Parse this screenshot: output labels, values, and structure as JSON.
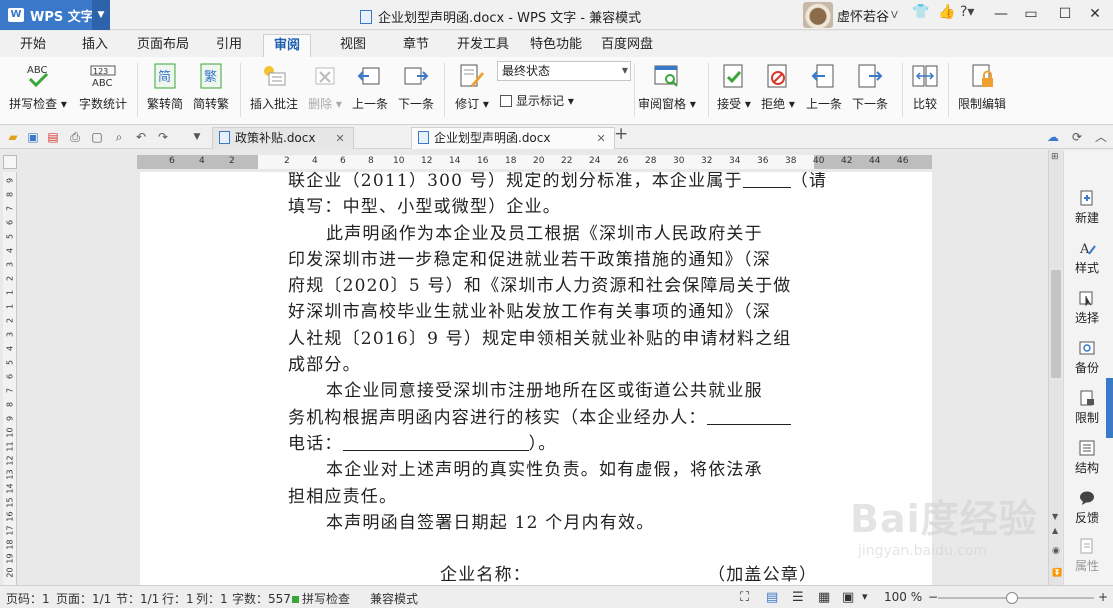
{
  "app": {
    "logo_text": "W",
    "name": "WPS 文字",
    "window_title": "企业划型声明函.docx - WPS 文字 - 兼容模式",
    "user_name": "虚怀若谷"
  },
  "menu_tabs": [
    "开始",
    "插入",
    "页面布局",
    "引用",
    "审阅",
    "视图",
    "章节",
    "开发工具",
    "特色功能",
    "百度网盘"
  ],
  "active_tab": "审阅",
  "ribbon": {
    "spell_check": "拼写检查",
    "word_count": "字数统计",
    "trad_to_simp": "繁转简",
    "simp_to_trad": "简转繁",
    "insert_comment": "插入批注",
    "delete": "删除",
    "prev_comment": "上一条",
    "next_comment": "下一条",
    "revise": "修订",
    "display_state": "最终状态",
    "show_markup": "显示标记",
    "review_pane": "审阅窗格",
    "accept": "接受",
    "reject": "拒绝",
    "prev_change": "上一条",
    "next_change": "下一条",
    "compare": "比较",
    "restrict_edit": "限制编辑"
  },
  "doc_tabs": [
    {
      "name": "政策补贴.docx",
      "active": false
    },
    {
      "name": "企业划型声明函.docx",
      "active": true
    }
  ],
  "ruler": {
    "h_left": [
      "6",
      "4",
      "2"
    ],
    "h_right": [
      "2",
      "4",
      "6",
      "8",
      "10",
      "12",
      "14",
      "16",
      "18",
      "20",
      "22",
      "24",
      "26",
      "28",
      "30",
      "32",
      "34",
      "36",
      "38",
      "40",
      "42",
      "44",
      "46"
    ],
    "v": [
      "9",
      "8",
      "7",
      "6",
      "5",
      "4",
      "3",
      "2",
      "1",
      "1",
      "2",
      "3",
      "4",
      "5",
      "6",
      "7",
      "8",
      "9",
      "10",
      "11",
      "12",
      "13",
      "14",
      "15",
      "16",
      "17",
      "18",
      "19",
      "20",
      "21",
      "22"
    ]
  },
  "document": {
    "lines": [
      "联企业（2011）300 号）规定的划分标准，本企业属于",
      "（请",
      "填写：中型、小型或微型）企业。",
      "此声明函作为本企业及员工根据《深圳市人民政府关于",
      "印发深圳市进一步稳定和促进就业若干政策措施的通知》（深",
      "府规〔2020〕5 号）和《深圳市人力资源和社会保障局关于做",
      "好深圳市高校毕业生就业补贴发放工作有关事项的通知》（深",
      "人社规〔2016〕9 号）规定申领相关就业补贴的申请材料之组",
      "成部分。",
      "本企业同意接受深圳市注册地所在区或街道公共就业服",
      "务机构根据声明函内容进行的核实（本企业经办人：",
      "电话：",
      "）。",
      "本企业对上述声明的真实性负责。如有虚假，将依法承",
      "担相应责任。",
      "本声明函自签署日期起 12 个月内有效。",
      "企业名称：",
      "（加盖公章）"
    ]
  },
  "side_panel": [
    "新建",
    "样式",
    "选择",
    "备份",
    "限制",
    "结构",
    "反馈",
    "属性"
  ],
  "status": {
    "page_num": "页码：1",
    "pages": "页面：1/1",
    "section": "节：1/1",
    "row": "行：1",
    "column": "列：1",
    "word_count": "字数：557",
    "spell_check": "拼写检查",
    "compat_mode": "兼容模式",
    "zoom": "100 %"
  },
  "watermark": {
    "text": "Bai度经验",
    "url": "jingyan.baidu.com"
  },
  "colors": {
    "accent": "#3a78c9",
    "green": "#3aa63a"
  }
}
